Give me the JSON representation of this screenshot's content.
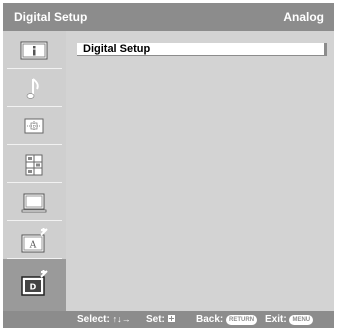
{
  "header": {
    "title": "Digital Setup",
    "mode": "Analog"
  },
  "sidebar": {
    "items": [
      {
        "icon": "info-icon",
        "selected": false
      },
      {
        "icon": "music-note-icon",
        "selected": false
      },
      {
        "icon": "picture-adjust-icon",
        "selected": false
      },
      {
        "icon": "channel-setup-icon",
        "selected": false
      },
      {
        "icon": "screen-icon",
        "selected": false
      },
      {
        "icon": "analog-setup-icon",
        "selected": false
      },
      {
        "icon": "digital-setup-icon",
        "selected": true
      }
    ],
    "badges": {
      "analog": "A",
      "digital": "D"
    }
  },
  "main": {
    "items": [
      {
        "label": "Digital Setup"
      }
    ]
  },
  "footer": {
    "select_label": "Select:",
    "select_arrows": "↑↓→",
    "set_label": "Set:",
    "back_label": "Back:",
    "back_key": "RETURN",
    "exit_label": "Exit:",
    "exit_key": "MENU"
  },
  "colors": {
    "bar": "#8c8c8c",
    "sidebar": "#cfcfcf",
    "content": "#d3d3d3",
    "selected": "#9a9a9a"
  }
}
